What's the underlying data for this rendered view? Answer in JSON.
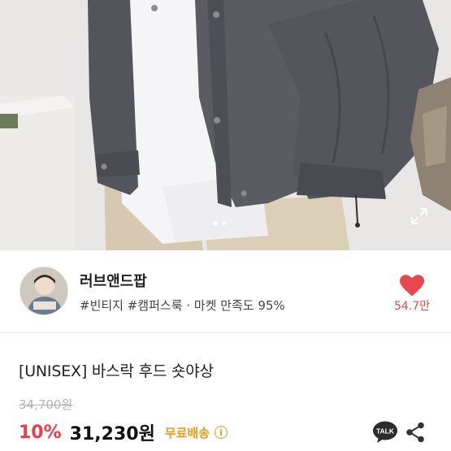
{
  "photo": {
    "image_alt": "product photo - charcoal hooded jacket over white tee and beige pants",
    "indicator": {
      "total": 2,
      "active": 0
    },
    "expand_icon": "expand-icon"
  },
  "seller": {
    "name": "러브앤드팝",
    "subtitle": "#빈티지 #캠퍼스룩 · 마켓 만족도 95%",
    "like_count": "54.7만",
    "like_icon": "heart-icon"
  },
  "product": {
    "title": "[UNISEX] 바스락 후드 숏야상",
    "original_price": "34,700원",
    "discount": "10%",
    "price": "31,230원",
    "shipping": "무료배송",
    "info_glyph": "i"
  },
  "actions": {
    "talk_label": "TALK"
  },
  "colors": {
    "accent_red": "#ea3c4b",
    "heart": "#e8474c",
    "shipping": "#f09b15"
  }
}
